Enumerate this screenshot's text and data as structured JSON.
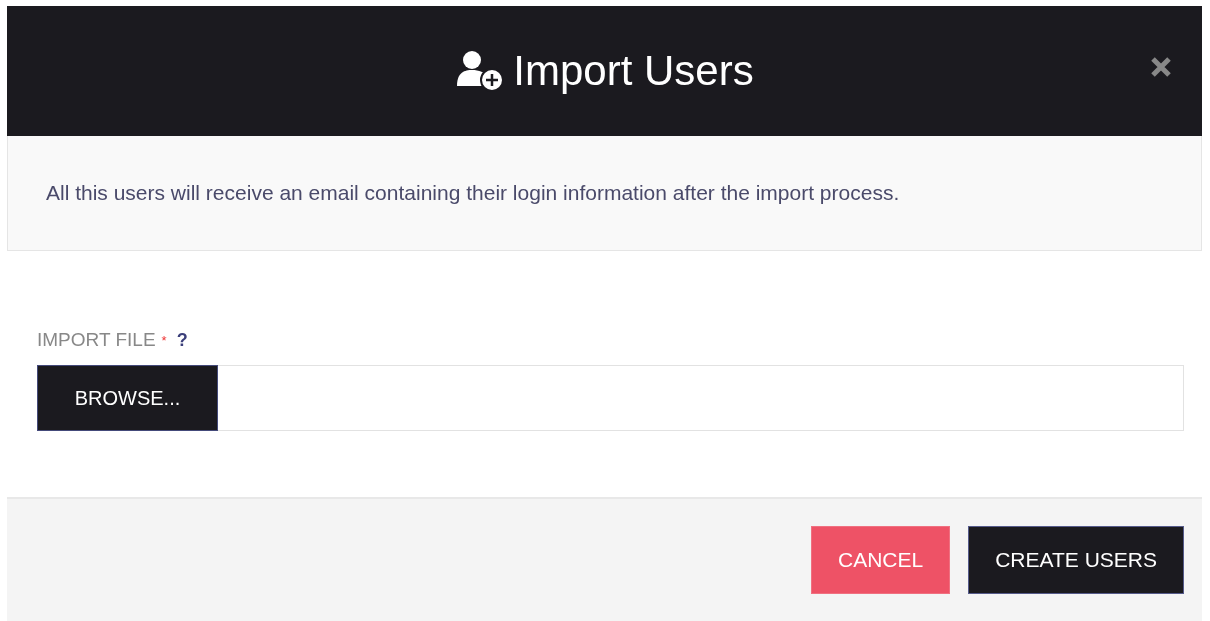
{
  "dialog": {
    "title": "Import Users"
  },
  "notice": "All this users will receive an email containing their login information after the import process.",
  "field": {
    "label": "IMPORT FILE",
    "required_mark": "*",
    "help": "?",
    "browse_label": "BROWSE..."
  },
  "buttons": [
    {
      "label": "CANCEL",
      "kind": "danger"
    },
    {
      "label": "CREATE USERS",
      "kind": "primary"
    }
  ]
}
